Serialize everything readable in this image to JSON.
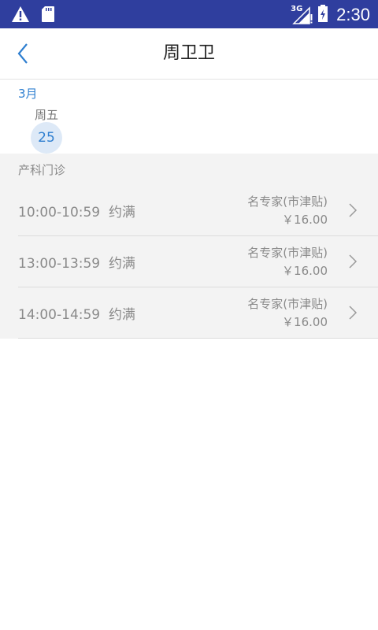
{
  "status_bar": {
    "time": "2:30",
    "network": "3G",
    "icons": [
      "warning-icon",
      "sd-card-icon",
      "signal-icon",
      "battery-icon"
    ]
  },
  "header": {
    "title": "周卫卫"
  },
  "calendar": {
    "month": "3月",
    "weekday": "周五",
    "day": "25"
  },
  "section": {
    "label": "产科门诊",
    "slots": [
      {
        "time": "10:00-10:59",
        "status": "约满",
        "type": "名专家(市津贴)",
        "price": "￥16.00"
      },
      {
        "time": "13:00-13:59",
        "status": "约满",
        "type": "名专家(市津贴)",
        "price": "￥16.00"
      },
      {
        "time": "14:00-14:59",
        "status": "约满",
        "type": "名专家(市津贴)",
        "price": "￥16.00"
      }
    ]
  },
  "colors": {
    "status_bar": "#2f3e9e",
    "accent": "#2f7fd0",
    "list_bg": "#f3f3f3"
  }
}
